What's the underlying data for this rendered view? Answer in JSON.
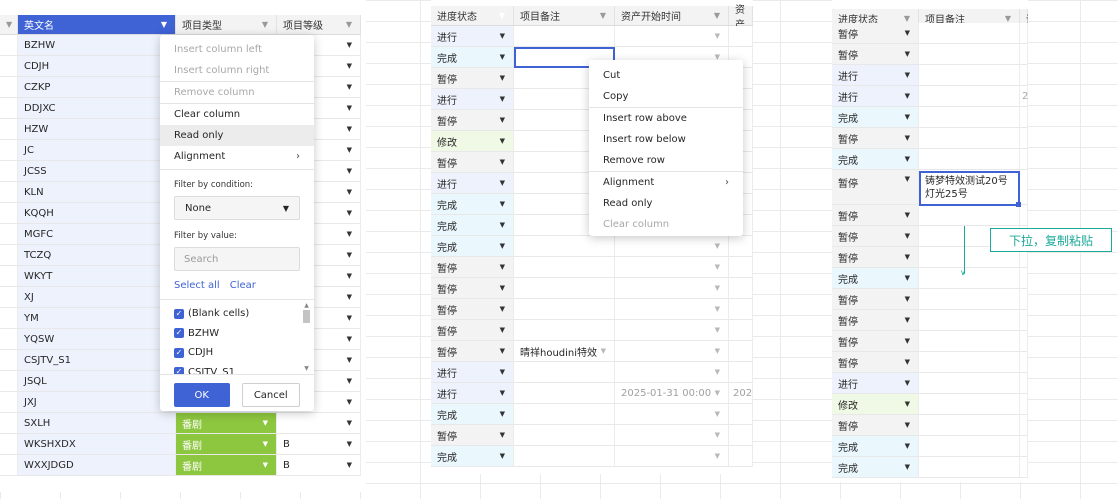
{
  "status_colors": {
    "进行": "#eef2fd",
    "完成": "#eaf7fd",
    "暂停": "#f3f3f3",
    "修改": "#f0f9e6"
  },
  "left": {
    "headers": [
      "英文名",
      "项目类型",
      "项目等级"
    ],
    "names": [
      "BZHW",
      "CDJH",
      "CZKP",
      "DDJXC",
      "HZW",
      "JC",
      "JCSS",
      "KLN",
      "KQQH",
      "MGFC",
      "TCZQ",
      "WKYT",
      "XJ",
      "YM",
      "YQSW",
      "CSJTV_S1",
      "JSQL",
      "JXJ",
      "SXLH",
      "WKSHXDX",
      "WXXJDGD"
    ],
    "type_colors": [
      "#eef8e6",
      "#eef8e6",
      "#eef4ff",
      "#eef8e6",
      "#eef8e6",
      "#fdebe0",
      "#eef8e6",
      "#eef4ff",
      "#fdebe0",
      "#eef8e6",
      "#eef8e6",
      "#ffffff",
      "#fdebe0",
      "#fdebe0",
      "#fdebe0",
      "#eef8e6",
      "#fdebe0",
      "#eef4ff",
      "#8dc63f",
      "#8dc63f",
      "#8dc63f"
    ],
    "type_labels": [
      "",
      "",
      "",
      "",
      "",
      "",
      "",
      "",
      "",
      "",
      "",
      "",
      "",
      "",
      "",
      "",
      "",
      "",
      "番剧",
      "番剧",
      "番剧"
    ],
    "levels": [
      "",
      "",
      "",
      "",
      "",
      "",
      "",
      "",
      "",
      "",
      "",
      "",
      "",
      "",
      "",
      "",
      "",
      "",
      "",
      "B",
      "B"
    ]
  },
  "left_menu": {
    "insert_left": "Insert column left",
    "insert_right": "Insert column right",
    "remove_column": "Remove column",
    "clear_column": "Clear column",
    "read_only": "Read only",
    "alignment": "Alignment",
    "filter_condition_label": "Filter by condition:",
    "condition_value": "None",
    "filter_value_label": "Filter by value:",
    "search_placeholder": "Search",
    "select_all": "Select all",
    "clear": "Clear",
    "values": [
      "(Blank cells)",
      "BZHW",
      "CDJH",
      "CSJTV_S1"
    ],
    "ok": "OK",
    "cancel": "Cancel"
  },
  "middle": {
    "headers": [
      "进度状态",
      "项目备注",
      "资产开始时间",
      "资产"
    ],
    "statuses": [
      "进行",
      "完成",
      "暂停",
      "进行",
      "暂停",
      "修改",
      "暂停",
      "进行",
      "完成",
      "完成",
      "完成",
      "暂停",
      "暂停",
      "暂停",
      "暂停",
      "暂停",
      "进行",
      "进行",
      "完成",
      "暂停",
      "完成"
    ],
    "note_row": 15,
    "note_text": "晴祥houdini特效",
    "date_row": 17,
    "date_text": "2025-01-31 00:00",
    "date_next": "202"
  },
  "mid_menu": {
    "cut": "Cut",
    "copy": "Copy",
    "insert_above": "Insert row above",
    "insert_below": "Insert row below",
    "remove_row": "Remove row",
    "alignment": "Alignment",
    "read_only": "Read only",
    "clear_column": "Clear column"
  },
  "right": {
    "headers": [
      "进度状态",
      "项目备注",
      "语"
    ],
    "statuses_top": [
      "暂停",
      "暂停",
      "进行",
      "进行",
      "完成",
      "暂停",
      "完成",
      "暂停"
    ],
    "statuses_bottom": [
      "暂停",
      "暂停",
      "暂停",
      "完成",
      "暂停",
      "暂停",
      "暂停",
      "暂停",
      "进行",
      "修改",
      "暂停",
      "完成",
      "完成"
    ],
    "edit_line1": "铸梦特效测试20号",
    "edit_line2": "灯光25号",
    "stray_char": "2"
  },
  "annotation": "下拉，复制粘贴"
}
